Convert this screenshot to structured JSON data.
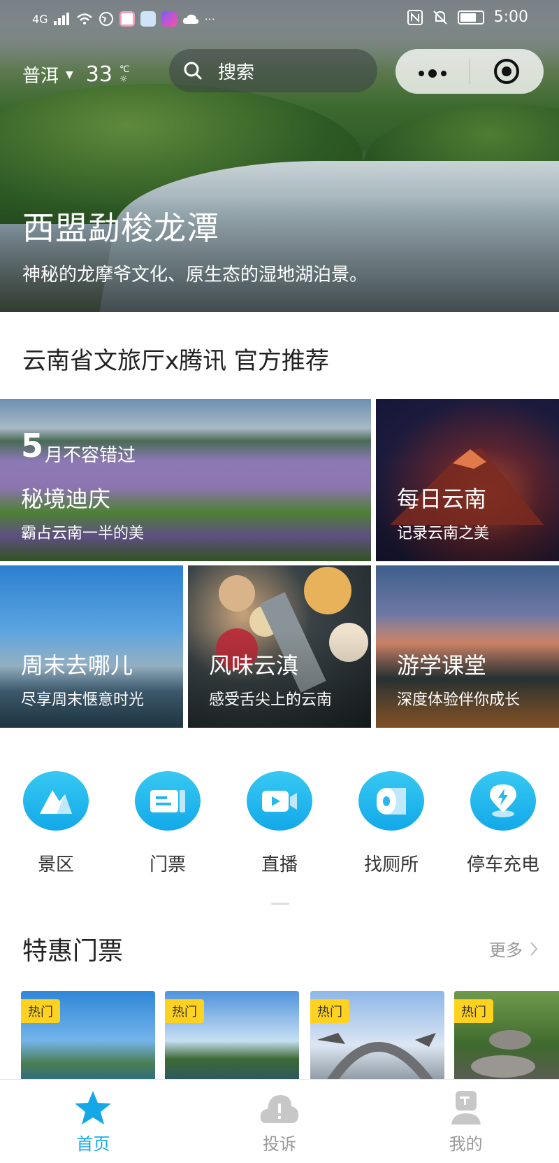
{
  "status_bar": {
    "network": "4G",
    "dots": "···",
    "time": "5:00"
  },
  "topbar": {
    "city": "普洱",
    "temperature": "33",
    "temperature_unit": "℃",
    "search_label": "搜索"
  },
  "hero": {
    "title": "西盟勐梭龙潭",
    "subtitle": "神秘的龙摩爷文化、原生态的湿地湖泊景。"
  },
  "recommend_title": "云南省文旅厅x腾讯 官方推荐",
  "tiles": [
    {
      "big_number": "5",
      "tag": "月不容错过",
      "title": "秘境迪庆",
      "subtitle": "霸占云南一半的美"
    },
    {
      "title": "每日云南",
      "subtitle": "记录云南之美"
    },
    {
      "title": "周末去哪儿",
      "subtitle": "尽享周末惬意时光"
    },
    {
      "title": "风味云滇",
      "subtitle": "感受舌尖上的云南"
    },
    {
      "title": "游学课堂",
      "subtitle": "深度体验伴你成长"
    }
  ],
  "quick_actions": [
    {
      "label": "景区",
      "icon": "mountain-icon"
    },
    {
      "label": "门票",
      "icon": "ticket-icon"
    },
    {
      "label": "直播",
      "icon": "video-icon"
    },
    {
      "label": "找厕所",
      "icon": "toilet-paper-icon"
    },
    {
      "label": "停车充电",
      "icon": "charging-pin-icon"
    }
  ],
  "tickets": {
    "title": "特惠门票",
    "more": "更多",
    "items": [
      {
        "badge": "热门"
      },
      {
        "badge": "热门"
      },
      {
        "badge": "热门"
      },
      {
        "badge": "热门"
      }
    ]
  },
  "tabbar": [
    {
      "label": "首页",
      "icon": "star-icon",
      "active": true
    },
    {
      "label": "投诉",
      "icon": "complaint-icon",
      "active": false
    },
    {
      "label": "我的",
      "icon": "profile-icon",
      "active": false
    }
  ],
  "colors": {
    "accent": "#15a8e8",
    "badge": "#ffd21f",
    "inactive": "#999999"
  }
}
